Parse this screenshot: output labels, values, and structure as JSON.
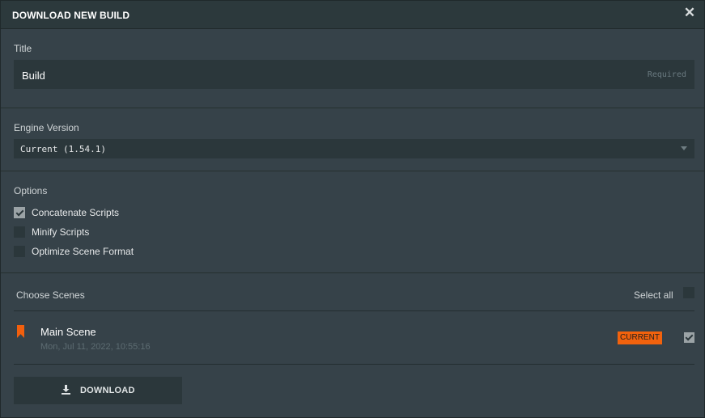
{
  "header": {
    "title": "DOWNLOAD NEW BUILD",
    "close_icon": "close-icon"
  },
  "title_field": {
    "label": "Title",
    "value": "Build",
    "placeholder": "Required"
  },
  "engine": {
    "label": "Engine Version",
    "selected": "Current (1.54.1)"
  },
  "options": {
    "label": "Options",
    "items": [
      {
        "label": "Concatenate Scripts",
        "checked": true
      },
      {
        "label": "Minify Scripts",
        "checked": false
      },
      {
        "label": "Optimize Scene Format",
        "checked": false
      }
    ]
  },
  "scenes": {
    "label": "Choose Scenes",
    "select_all": "Select all",
    "items": [
      {
        "name": "Main Scene",
        "date": "Mon, Jul 11, 2022, 10:55:16",
        "badge": "CURRENT",
        "checked": true
      }
    ]
  },
  "download": {
    "label": "DOWNLOAD",
    "icon": "download-icon"
  },
  "colors": {
    "accent": "#f2620d",
    "background": "#364249",
    "field": "#2b373b"
  }
}
